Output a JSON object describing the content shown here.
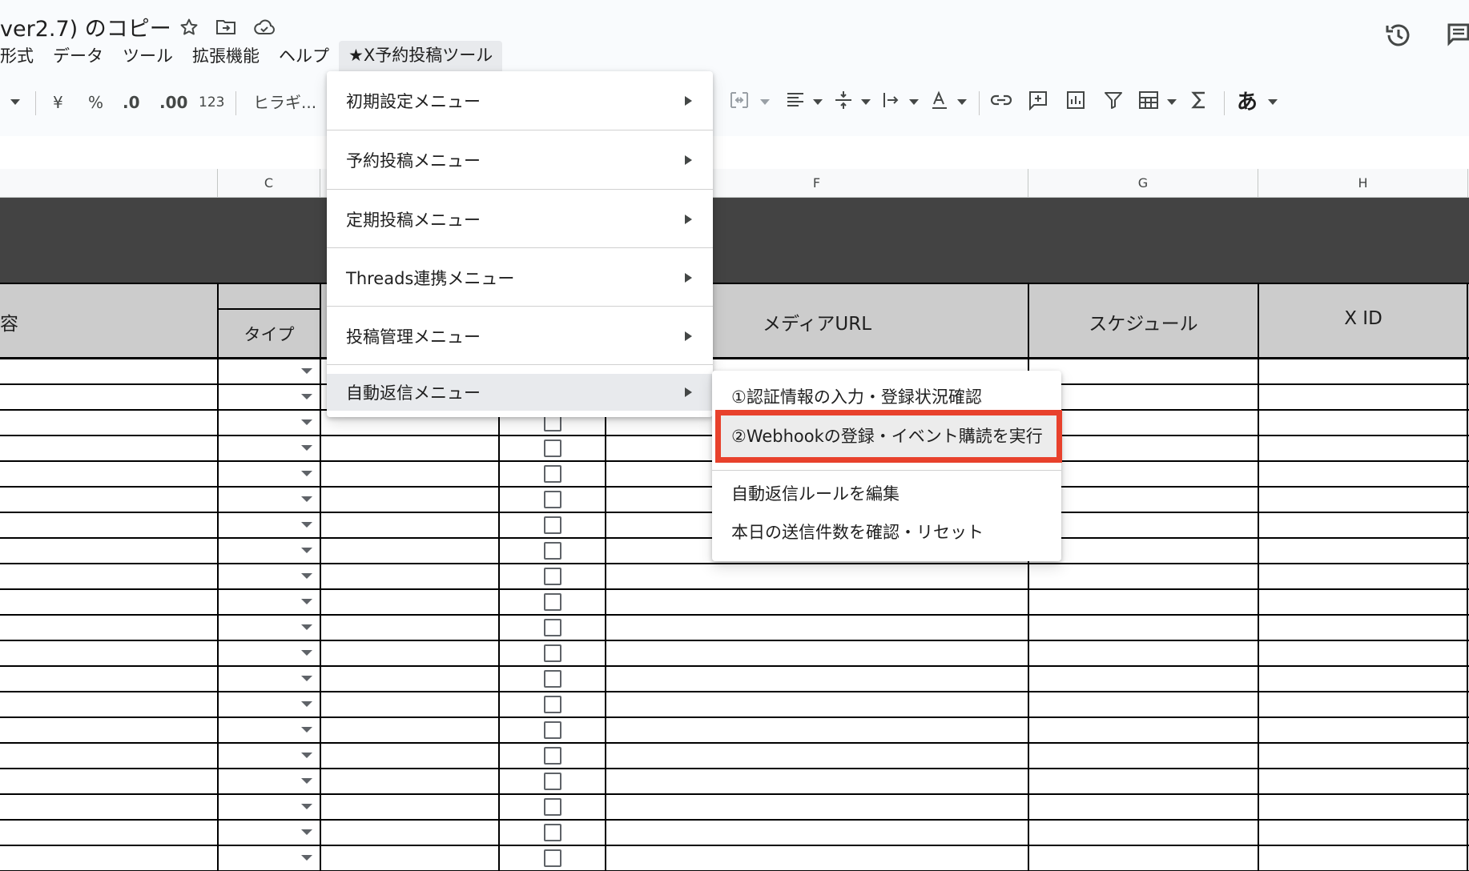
{
  "doc": {
    "title": "ver2.7) のコピー"
  },
  "menubar": [
    "形式",
    "データ",
    "ツール",
    "拡張機能",
    "ヘルプ",
    "★X予約投稿ツール"
  ],
  "toolbar": {
    "currency": "¥",
    "percent": "%",
    "dec_decrease": ".0",
    "dec_increase": ".00",
    "number_format": "123",
    "font": "ヒラギ...",
    "ime": "あ"
  },
  "columns": [
    "C",
    "F",
    "G",
    "H"
  ],
  "sheet": {
    "headers": {
      "partial": "容",
      "type": "タイプ",
      "media_url": "メディアURL",
      "schedule": "スケジュール",
      "x_id": "X ID"
    }
  },
  "main_menu": {
    "items": [
      {
        "label": "初期設定メニュー",
        "submenu": true
      },
      {
        "label": "予約投稿メニュー",
        "submenu": true
      },
      {
        "label": "定期投稿メニュー",
        "submenu": true
      },
      {
        "label": "Threads連携メニュー",
        "submenu": true
      },
      {
        "label": "投稿管理メニュー",
        "submenu": true
      },
      {
        "label": "自動返信メニュー",
        "submenu": true,
        "highlighted": true
      }
    ]
  },
  "sub_menu": {
    "items": [
      {
        "label": "①認証情報の入力・登録状況確認"
      },
      {
        "label": "②Webhookの登録・イベント購読を実行",
        "highlighted": true
      },
      {
        "label": "自動返信ルールを編集"
      },
      {
        "label": "本日の送信件数を確認・リセット"
      }
    ]
  },
  "colors": {
    "highlight_border": "#e8412c",
    "dark_band": "#434343",
    "header_fill": "#cccccc",
    "menu_hover": "#e8eaed"
  }
}
